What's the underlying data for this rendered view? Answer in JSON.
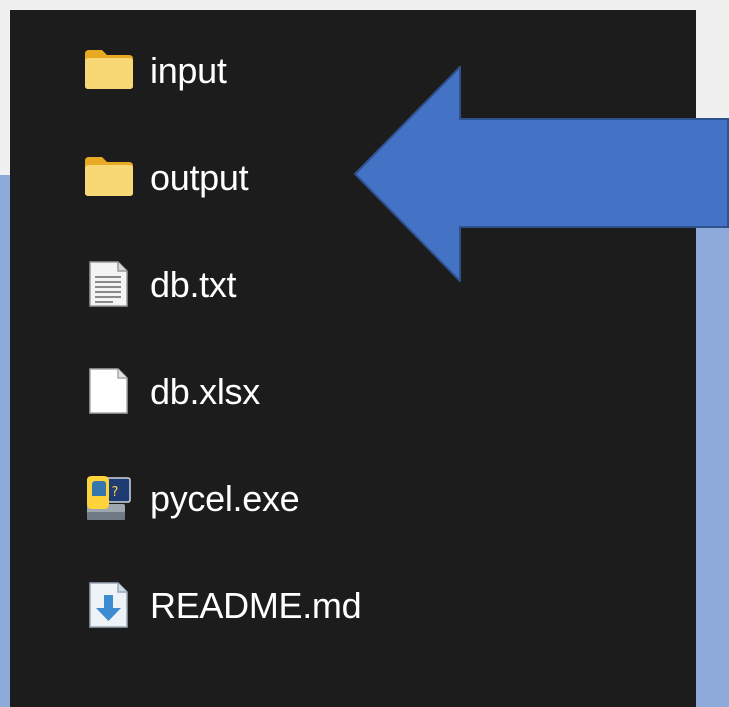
{
  "explorer": {
    "items": [
      {
        "name": "input",
        "icon": "folder-icon"
      },
      {
        "name": "output",
        "icon": "folder-icon"
      },
      {
        "name": "db.txt",
        "icon": "text-file-icon"
      },
      {
        "name": "db.xlsx",
        "icon": "blank-file-icon"
      },
      {
        "name": "pycel.exe",
        "icon": "python-exe-icon"
      },
      {
        "name": "README.md",
        "icon": "markdown-file-icon"
      }
    ]
  },
  "annotation": {
    "icon": "left-arrow-icon",
    "color": "#4472c4",
    "border_color": "#2f528f"
  },
  "colors": {
    "panel_background": "#1c1c1c",
    "page_background": "#f0f0f0",
    "accent_background": "#8eaadb",
    "text": "#ffffff",
    "folder": "#f8d775"
  }
}
